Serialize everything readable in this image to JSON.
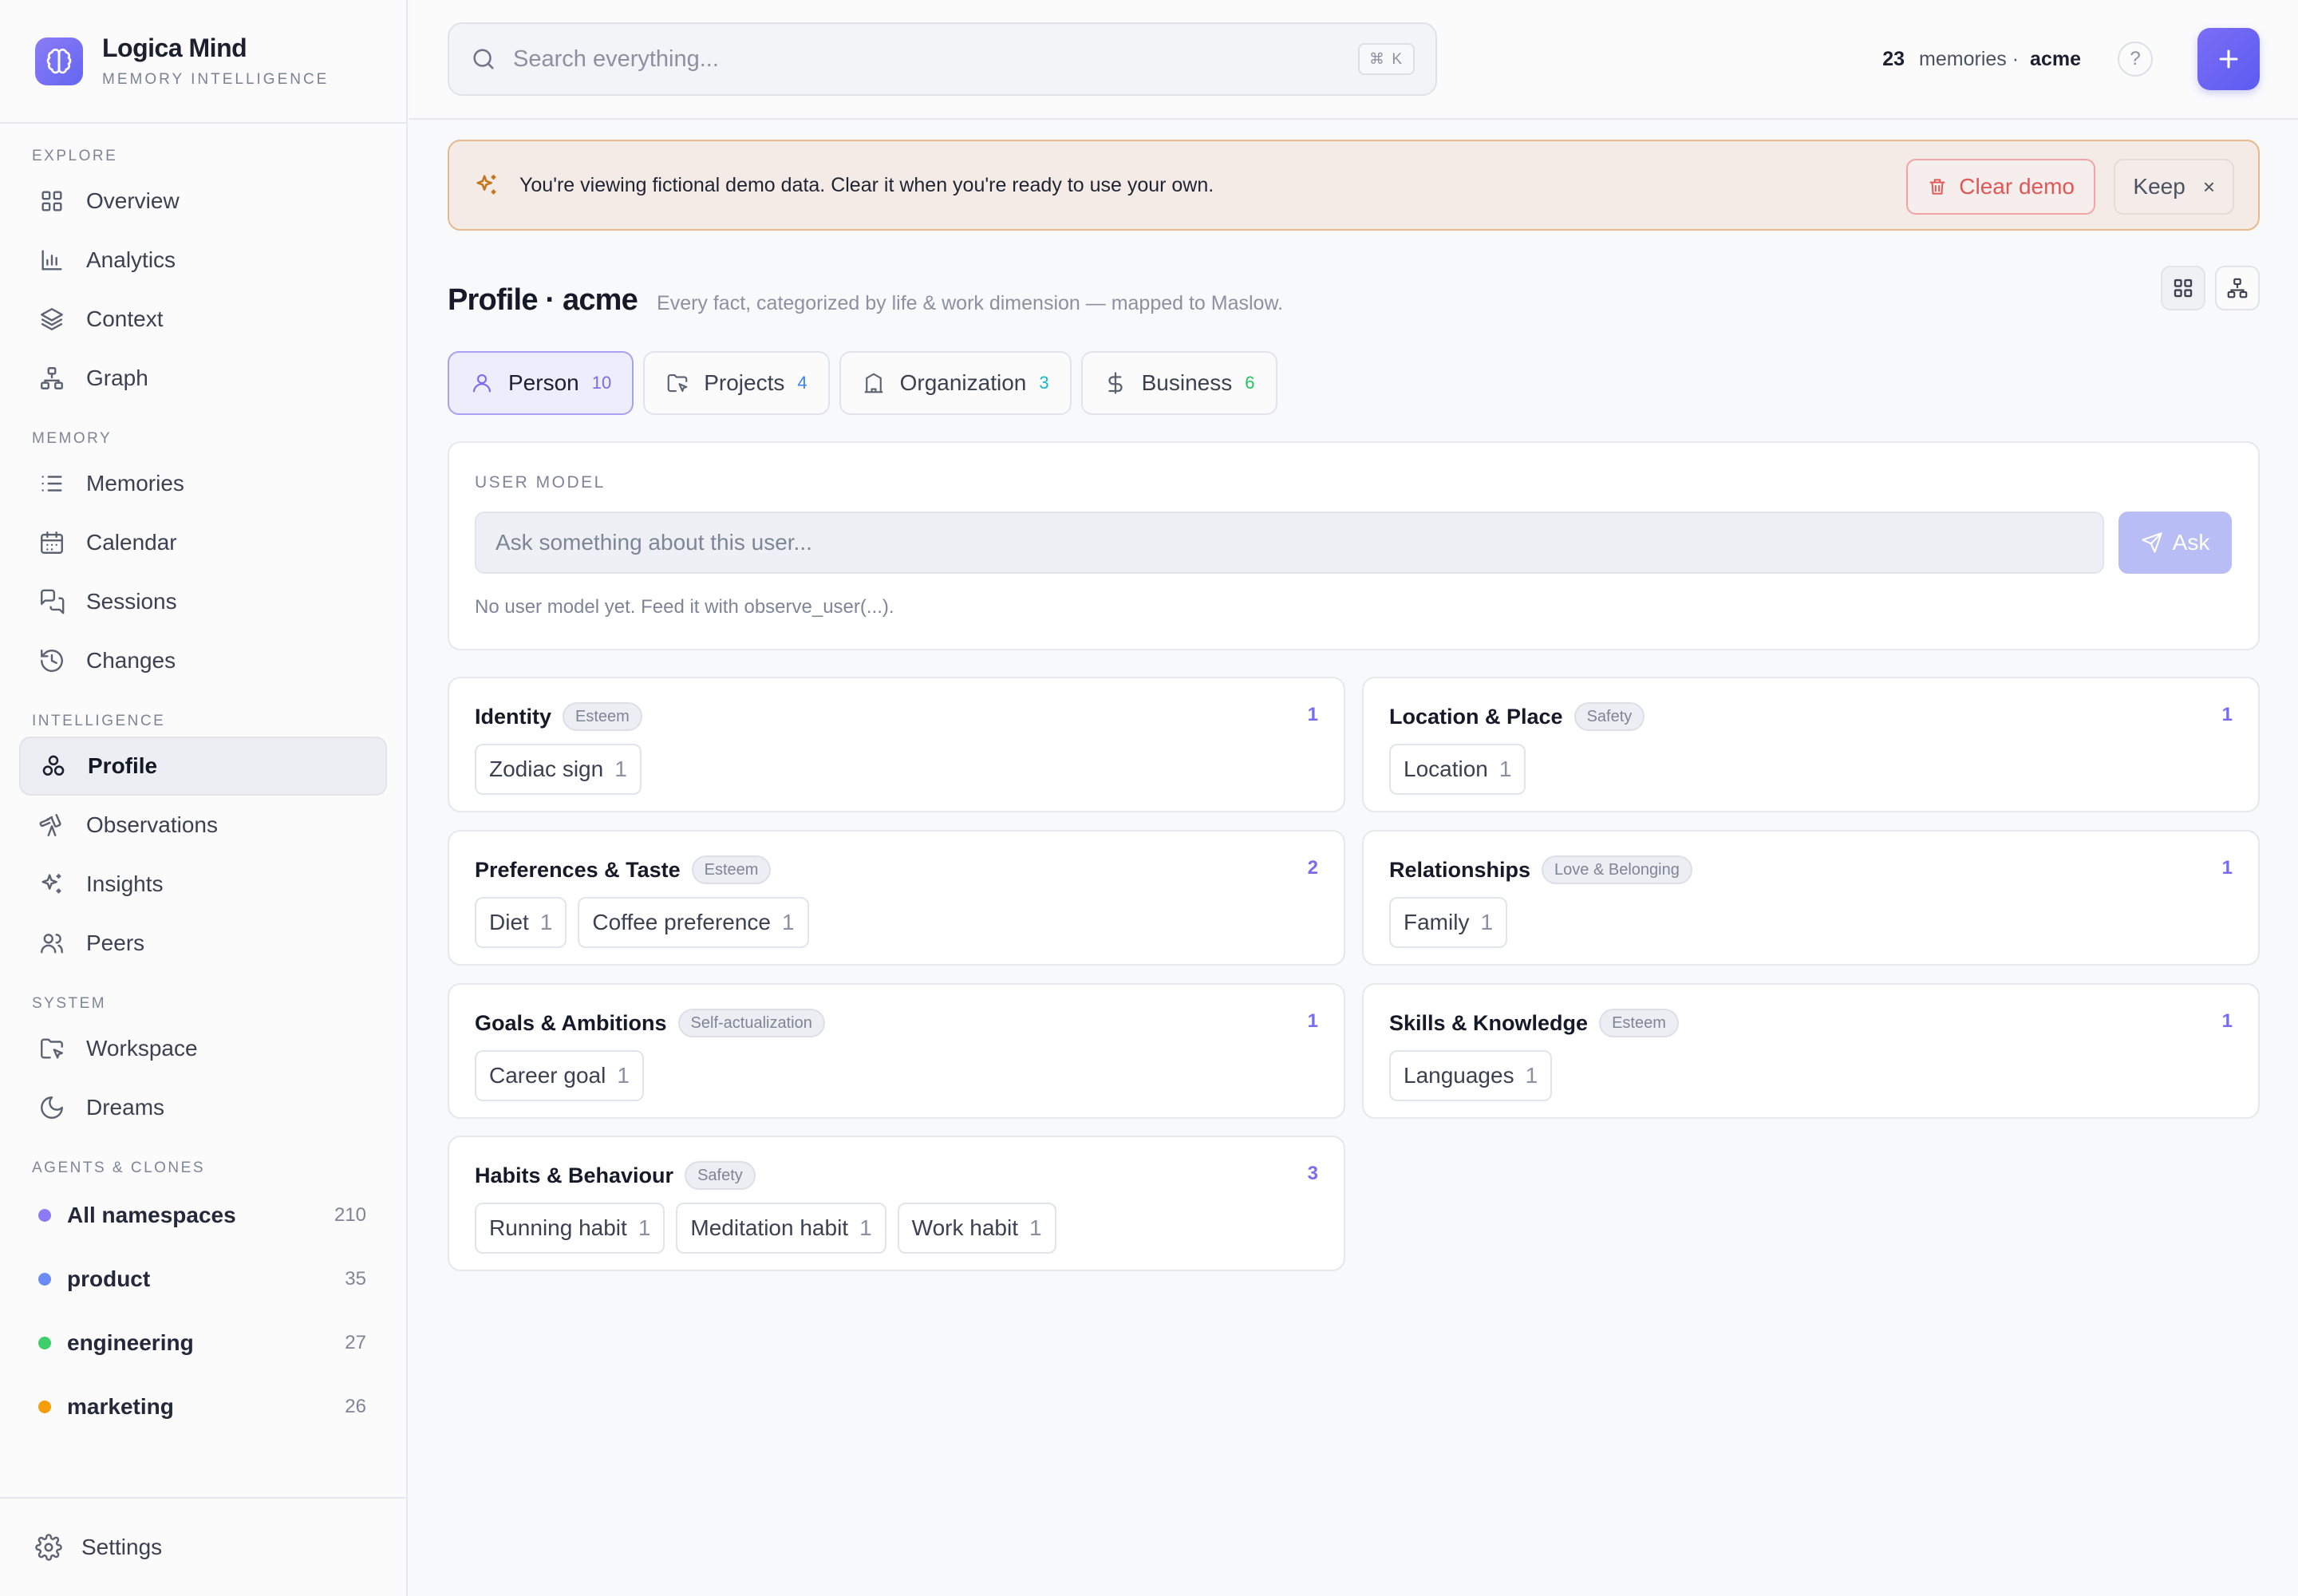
{
  "brand": {
    "name": "Logica Mind",
    "subtitle": "MEMORY INTELLIGENCE"
  },
  "sidebar": {
    "sections": {
      "explore": "EXPLORE",
      "memory": "MEMORY",
      "intelligence": "INTELLIGENCE",
      "system": "SYSTEM",
      "agents": "AGENTS & CLONES"
    },
    "explore": [
      {
        "label": "Overview",
        "icon": "grid-icon"
      },
      {
        "label": "Analytics",
        "icon": "bar-chart-icon"
      },
      {
        "label": "Context",
        "icon": "layers-icon"
      },
      {
        "label": "Graph",
        "icon": "graph-icon"
      }
    ],
    "memory": [
      {
        "label": "Memories",
        "icon": "list-icon"
      },
      {
        "label": "Calendar",
        "icon": "calendar-icon"
      },
      {
        "label": "Sessions",
        "icon": "chat-icon"
      },
      {
        "label": "Changes",
        "icon": "history-icon"
      }
    ],
    "intelligence": [
      {
        "label": "Profile",
        "icon": "profile-icon",
        "active": true
      },
      {
        "label": "Observations",
        "icon": "telescope-icon"
      },
      {
        "label": "Insights",
        "icon": "sparkles-icon"
      },
      {
        "label": "Peers",
        "icon": "users-icon"
      }
    ],
    "system": [
      {
        "label": "Workspace",
        "icon": "folder-icon"
      },
      {
        "label": "Dreams",
        "icon": "moon-icon"
      }
    ],
    "namespaces": [
      {
        "label": "All namespaces",
        "count": "210",
        "color": "#8b7cf6"
      },
      {
        "label": "product",
        "count": "35",
        "color": "#6b8cf5"
      },
      {
        "label": "engineering",
        "count": "27",
        "color": "#3ecf6a"
      },
      {
        "label": "marketing",
        "count": "26",
        "color": "#f59e0b"
      }
    ],
    "settings": "Settings"
  },
  "topbar": {
    "search_placeholder": "Search everything...",
    "shortcut": "⌘ K",
    "memory_count": "23",
    "memory_label": "memories ·",
    "namespace": "acme",
    "help": "?"
  },
  "banner": {
    "text": "You're viewing fictional demo data. Clear it when you're ready to use your own.",
    "clear_label": "Clear demo",
    "keep_label": "Keep",
    "keep_close": "×"
  },
  "profile": {
    "title": "Profile · acme",
    "subtitle": "Every fact, categorized by life & work dimension — mapped to Maslow."
  },
  "tabs": [
    {
      "label": "Person",
      "count": "10",
      "color": "#7a6cf0",
      "icon": "user-icon"
    },
    {
      "label": "Projects",
      "count": "4",
      "color": "#3b82f6",
      "icon": "folder-icon"
    },
    {
      "label": "Organization",
      "count": "3",
      "color": "#14b8c7",
      "icon": "building-icon"
    },
    {
      "label": "Business",
      "count": "6",
      "color": "#22c55e",
      "icon": "dollar-icon"
    }
  ],
  "user_model": {
    "label": "USER MODEL",
    "placeholder": "Ask something about this user...",
    "ask_label": "Ask",
    "note": "No user model yet. Feed it with observe_user(...)."
  },
  "cards": [
    {
      "title": "Identity",
      "badge": "Esteem",
      "count": "1",
      "chips": [
        {
          "label": "Zodiac sign",
          "count": "1"
        }
      ]
    },
    {
      "title": "Location & Place",
      "badge": "Safety",
      "count": "1",
      "chips": [
        {
          "label": "Location",
          "count": "1"
        }
      ]
    },
    {
      "title": "Preferences & Taste",
      "badge": "Esteem",
      "count": "2",
      "chips": [
        {
          "label": "Diet",
          "count": "1"
        },
        {
          "label": "Coffee preference",
          "count": "1"
        }
      ]
    },
    {
      "title": "Relationships",
      "badge": "Love & Belonging",
      "count": "1",
      "chips": [
        {
          "label": "Family",
          "count": "1"
        }
      ]
    },
    {
      "title": "Goals & Ambitions",
      "badge": "Self-actualization",
      "count": "1",
      "chips": [
        {
          "label": "Career goal",
          "count": "1"
        }
      ]
    },
    {
      "title": "Skills & Knowledge",
      "badge": "Esteem",
      "count": "1",
      "chips": [
        {
          "label": "Languages",
          "count": "1"
        }
      ]
    },
    {
      "title": "Habits & Behaviour",
      "badge": "Safety",
      "count": "3",
      "chips": [
        {
          "label": "Running habit",
          "count": "1"
        },
        {
          "label": "Meditation habit",
          "count": "1"
        },
        {
          "label": "Work habit",
          "count": "1"
        }
      ]
    }
  ]
}
